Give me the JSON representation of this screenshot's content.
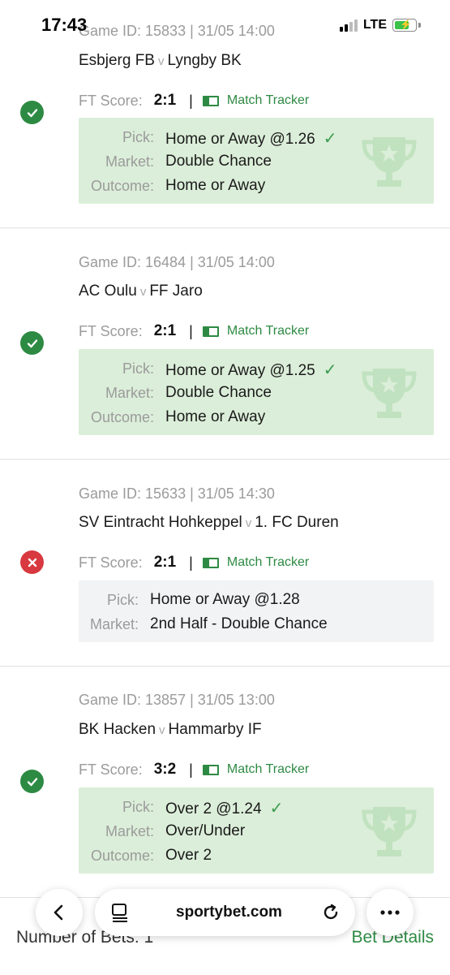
{
  "status": {
    "time": "17:43",
    "network": "LTE"
  },
  "cards": [
    {
      "game_id": "Game ID: 15833 | 31/05 14:00",
      "home": "Esbjerg FB",
      "vs": "v",
      "away": "Lyngby BK",
      "result": "win",
      "ft_label": "FT Score:",
      "ft_score": "2:1",
      "tracker": "Match Tracker",
      "pick_label": "Pick:",
      "pick": "Home or Away @1.26",
      "market_label": "Market:",
      "market": "Double Chance",
      "outcome_label": "Outcome:",
      "outcome": "Home or Away"
    },
    {
      "game_id": "Game ID: 16484 | 31/05 14:00",
      "home": "AC Oulu",
      "vs": "v",
      "away": "FF Jaro",
      "result": "win",
      "ft_label": "FT Score:",
      "ft_score": "2:1",
      "tracker": "Match Tracker",
      "pick_label": "Pick:",
      "pick": "Home or Away @1.25",
      "market_label": "Market:",
      "market": "Double Chance",
      "outcome_label": "Outcome:",
      "outcome": "Home or Away"
    },
    {
      "game_id": "Game ID: 15633 | 31/05 14:30",
      "home": "SV Eintracht Hohkeppel",
      "vs": "v",
      "away": "1. FC Duren",
      "result": "loss",
      "ft_label": "FT Score:",
      "ft_score": "2:1",
      "tracker": "Match Tracker",
      "pick_label": "Pick:",
      "pick": "Home or Away @1.28",
      "market_label": "Market:",
      "market": "2nd Half - Double Chance"
    },
    {
      "game_id": "Game ID: 13857 | 31/05 13:00",
      "home": "BK Hacken",
      "vs": "v",
      "away": "Hammarby IF",
      "result": "win",
      "ft_label": "FT Score:",
      "ft_score": "3:2",
      "tracker": "Match Tracker",
      "pick_label": "Pick:",
      "pick": "Over 2 @1.24",
      "market_label": "Market:",
      "market": "Over/Under",
      "outcome_label": "Outcome:",
      "outcome": "Over 2"
    }
  ],
  "footer": {
    "num_bets": "Number of Bets: 1",
    "bet_details": "Bet Details"
  },
  "browser": {
    "url": "sportybet.com"
  },
  "colors": {
    "win": "#2d8a43",
    "loss": "#d8383f",
    "win_box": "#dbeed9"
  }
}
